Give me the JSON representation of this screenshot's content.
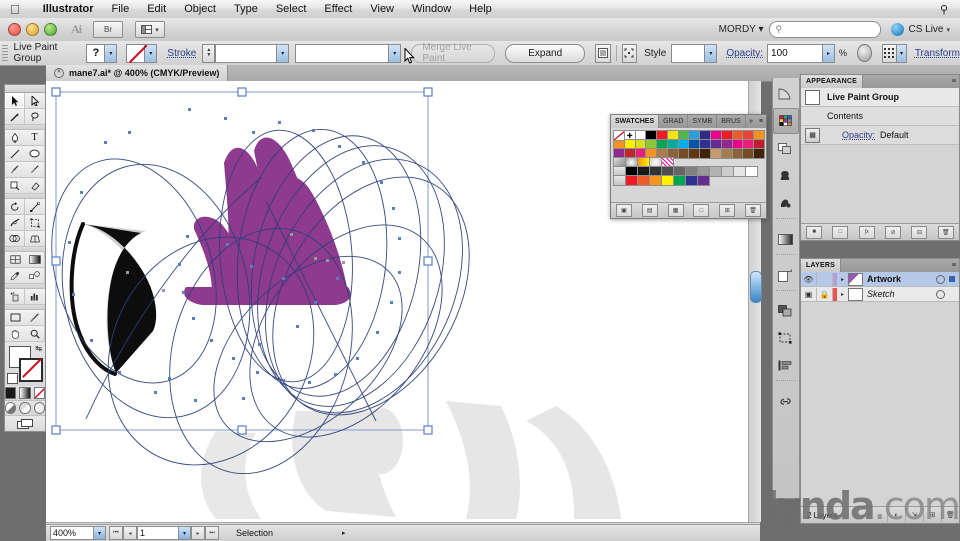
{
  "menubar": {
    "apple_icon": "apple-icon",
    "items": [
      {
        "label": "Illustrator",
        "bold": true
      },
      {
        "label": "File"
      },
      {
        "label": "Edit"
      },
      {
        "label": "Object"
      },
      {
        "label": "Type"
      },
      {
        "label": "Select"
      },
      {
        "label": "Effect"
      },
      {
        "label": "View"
      },
      {
        "label": "Window"
      },
      {
        "label": "Help"
      }
    ],
    "spotlight_icon": "search-icon"
  },
  "titlebar": {
    "app_badge": "Ai",
    "bridge_label": "Br",
    "arrange_icon": "arrange-documents-icon",
    "workspace_label": "MORDY",
    "search_placeholder": "",
    "search_icon": "search-icon",
    "cs_live_label": "CS Live"
  },
  "controlbar": {
    "selection_label": "Live Paint Group",
    "fill_label": "?",
    "stroke_label": "Stroke",
    "stroke_weight": "",
    "stroke_profile": "",
    "merge_label": "Merge Live Paint",
    "expand_label": "Expand",
    "style_label": "Style",
    "opacity_label": "Opacity:",
    "opacity_value": "100",
    "opacity_unit": "%",
    "transform_label": "Transform",
    "align_icon": "align-panel-icon",
    "isolate_icon": "isolate-group-icon",
    "recolor_icon": "recolor-artwork-icon",
    "transform_icon": "transform-anchor-icon"
  },
  "document": {
    "tab_title": "mane7.ai* @ 400% (CMYK/Preview)",
    "close_icon": "close-icon"
  },
  "toolbox": {
    "tools": [
      {
        "name": "selection-tool",
        "selected": true
      },
      {
        "name": "direct-selection-tool"
      },
      {
        "name": "magic-wand-tool"
      },
      {
        "name": "lasso-tool"
      },
      {
        "name": "pen-tool"
      },
      {
        "name": "type-tool"
      },
      {
        "name": "line-segment-tool"
      },
      {
        "name": "ellipse-tool"
      },
      {
        "name": "paintbrush-tool"
      },
      {
        "name": "pencil-tool"
      },
      {
        "name": "blob-brush-tool"
      },
      {
        "name": "eraser-tool"
      },
      {
        "name": "rotate-tool"
      },
      {
        "name": "scale-tool"
      },
      {
        "name": "width-tool"
      },
      {
        "name": "free-transform-tool"
      },
      {
        "name": "shape-builder-tool"
      },
      {
        "name": "perspective-grid-tool"
      },
      {
        "name": "mesh-tool"
      },
      {
        "name": "gradient-tool"
      },
      {
        "name": "eyedropper-tool"
      },
      {
        "name": "blend-tool"
      },
      {
        "name": "symbol-sprayer-tool"
      },
      {
        "name": "column-graph-tool"
      },
      {
        "name": "artboard-tool"
      },
      {
        "name": "slice-tool"
      },
      {
        "name": "hand-tool"
      },
      {
        "name": "zoom-tool"
      }
    ],
    "fill_swatch": "fill-swatch",
    "stroke_swatch": "stroke-swatch-none",
    "swap_icon": "swap-fill-stroke-icon",
    "default_icon": "default-fill-stroke-icon",
    "color_modes": [
      "color-swatch",
      "gradient-swatch",
      "none-swatch"
    ],
    "draw_modes": [
      "draw-normal-icon",
      "draw-behind-icon",
      "draw-inside-icon"
    ],
    "screen_mode_icon": "screen-mode-icon"
  },
  "swatches_panel": {
    "tabs": [
      {
        "label": "SWATCHES",
        "active": true
      },
      {
        "label": "GRAD",
        "active": false
      },
      {
        "label": "SYMB",
        "active": false
      },
      {
        "label": "BRUS",
        "active": false
      }
    ],
    "expand_icon": "expand-icon",
    "menu_icon": "panel-menu-icon",
    "rows": [
      [
        "none",
        "registration",
        "#ffffff",
        "#000000",
        "#ed1c24",
        "#f5e600",
        "#4fb848",
        "#2e9fd6",
        "#2d2e83",
        "#ec008c",
        "#ed1c24",
        "#f15a29",
        "#ef4136",
        "#f7941e"
      ],
      [
        "#f7941e",
        "#fff200",
        "#d7df23",
        "#8dc63f",
        "#00a651",
        "#00a99d",
        "#00aeef",
        "#0054a6",
        "#2e3192",
        "#662d91",
        "#92278f",
        "#ec008c",
        "#ed1e79",
        "#be1e2d"
      ],
      [
        "#92278f",
        "#c1272d",
        "#ed1e79",
        "#f7941e",
        "#a97c50",
        "#8c6239",
        "#754c24",
        "#603813",
        "#42210b",
        "#c69c6d",
        "#a67c52",
        "#8c6239",
        "#754c24",
        "#42210b"
      ],
      [
        "grad1",
        "grad2",
        "pattern1",
        "grad3",
        "pattern2"
      ],
      [
        "#000000",
        "#1a1a1a",
        "#333333",
        "#4d4d4d",
        "#666666",
        "#808080",
        "#999999",
        "#b3b3b3",
        "#cccccc",
        "#e6e6e6",
        "#ffffff"
      ],
      [
        "#ed1c24",
        "#f7941e",
        "#fff200",
        "#00a651",
        "#2e3192",
        "#662d91"
      ]
    ],
    "footer_buttons": [
      "swatch-libraries-icon",
      "show-swatch-kinds-icon",
      "swatch-options-icon",
      "new-color-group-icon",
      "new-swatch-icon",
      "delete-swatch-icon"
    ]
  },
  "dock": {
    "items": [
      {
        "name": "color-panel-icon"
      },
      {
        "name": "swatches-panel-icon",
        "active": true
      },
      {
        "name": "transparency-panel-icon"
      },
      {
        "name": "brushes-panel-icon"
      },
      {
        "name": "symbols-panel-icon"
      },
      {
        "name": "gradient-panel-icon"
      },
      {
        "name": "artboards-panel-icon"
      },
      {
        "name": "pathfinder-panel-icon"
      },
      {
        "name": "transform-panel-icon"
      },
      {
        "name": "align-panel-icon"
      },
      {
        "name": "links-panel-icon"
      }
    ]
  },
  "appearance_panel": {
    "tab_label": "APPEARANCE",
    "menu_icon": "panel-menu-icon",
    "target_label": "Live Paint Group",
    "contents_label": "Contents",
    "opacity_label": "Opacity:",
    "opacity_value": "Default",
    "footer_buttons": [
      "add-new-stroke-icon",
      "add-new-fill-icon",
      "add-new-effect-icon",
      "clear-appearance-icon",
      "duplicate-item-icon",
      "delete-item-icon"
    ]
  },
  "layers_panel": {
    "tab_label": "LAYERS",
    "menu_icon": "panel-menu-icon",
    "rows": [
      {
        "name": "Artwork",
        "selected": true,
        "italic": false,
        "color": "#b39ddb",
        "eye_icon": "eye-icon",
        "lock_icon": "lock-icon",
        "disclosure_icon": "chevron-right-icon"
      },
      {
        "name": "Sketch",
        "selected": false,
        "italic": true,
        "color": "#ef5350",
        "eye_icon": "template-icon",
        "lock_icon": "lock-icon",
        "disclosure_icon": "chevron-right-icon"
      }
    ],
    "count_label": "2 Layers",
    "footer_buttons": [
      "make-clipping-mask-icon",
      "create-sublayer-icon",
      "create-new-layer-icon",
      "delete-layer-icon"
    ]
  },
  "statusbar": {
    "zoom_value": "400%",
    "zoom_arrow_icon": "chevron-down-icon",
    "first_page_icon": "first-page-icon",
    "prev_page_icon": "prev-page-icon",
    "page_value": "1",
    "page_arrow_icon": "chevron-down-icon",
    "next_page_icon": "next-page-icon",
    "last_page_icon": "last-page-icon",
    "status_text": "Selection",
    "status_arrow_icon": "chevron-right-icon"
  },
  "watermark": {
    "part_bold": "lynda",
    "part_light": ".com"
  },
  "canvas": {
    "artwork_name": "live-paint-mane-artwork",
    "mane_color": "#8e3a8e",
    "ear_color": "#111111",
    "path_color": "#2f4f8f",
    "selection_color": "#5a7fbf"
  }
}
